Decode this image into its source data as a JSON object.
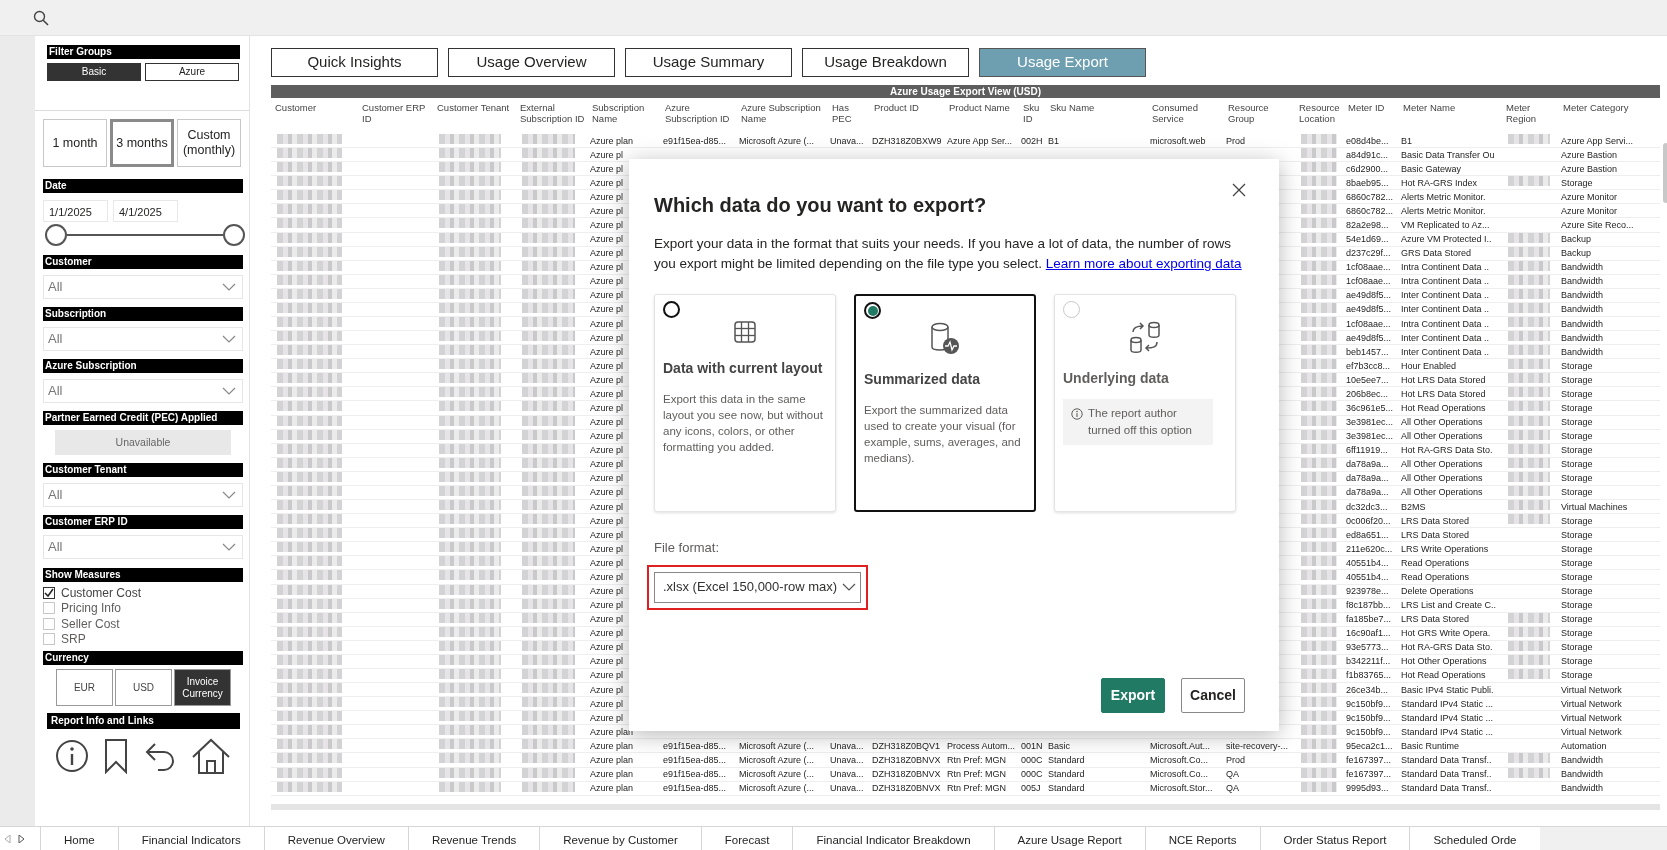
{
  "sidebar": {
    "filter_groups": {
      "title": "Filter Groups",
      "options": [
        {
          "label": "Basic",
          "selected": true
        },
        {
          "label": "Azure",
          "selected": false
        }
      ]
    },
    "periods": [
      {
        "label": "1 month",
        "selected": false
      },
      {
        "label": "3 months",
        "selected": true
      },
      {
        "label": "Custom (monthly)",
        "selected": false
      }
    ],
    "date": {
      "title": "Date",
      "start": "1/1/2025",
      "end": "4/1/2025",
      "level": 1
    },
    "filters": [
      {
        "kind": "dropdown",
        "title": "Customer",
        "value": "All"
      },
      {
        "kind": "dropdown",
        "title": "Subscription",
        "value": "All"
      },
      {
        "kind": "dropdown",
        "title": "Azure Subscription",
        "value": "All"
      },
      {
        "kind": "unavailable",
        "title": "Partner Earned Credit (PEC) Applied",
        "value": "Unavailable"
      },
      {
        "kind": "dropdown",
        "title": "Customer Tenant",
        "value": "All"
      },
      {
        "kind": "dropdown",
        "title": "Customer ERP ID",
        "value": "All"
      }
    ],
    "measures": {
      "title": "Show Measures",
      "items": [
        {
          "label": "Customer Cost",
          "checked": true
        },
        {
          "label": "Pricing Info",
          "checked": false
        },
        {
          "label": "Seller Cost",
          "checked": false
        },
        {
          "label": "SRP",
          "checked": false
        }
      ]
    },
    "currency": {
      "title": "Currency",
      "options": [
        {
          "label": "EUR",
          "selected": false
        },
        {
          "label": "USD",
          "selected": false
        },
        {
          "label": "Invoice Currency",
          "selected": true
        }
      ]
    },
    "report_info": {
      "title": "Report Info and Links"
    }
  },
  "tabs": [
    {
      "label": "Quick Insights",
      "selected": false
    },
    {
      "label": "Usage Overview",
      "selected": false
    },
    {
      "label": "Usage Summary",
      "selected": false
    },
    {
      "label": "Usage Breakdown",
      "selected": false
    },
    {
      "label": "Usage Export",
      "selected": true
    }
  ],
  "table": {
    "title": "Azure Usage Export View (USD)",
    "columns": [
      {
        "label": "Customer",
        "kind": "redacted"
      },
      {
        "label": "Customer ERP ID",
        "kind": "text"
      },
      {
        "label": "Customer Tenant",
        "kind": "redacted"
      },
      {
        "label": "External Subscription ID",
        "kind": "redacted"
      },
      {
        "label": "Subscription Name",
        "kind": "text"
      },
      {
        "label": "Azure Subscription ID",
        "kind": "text"
      },
      {
        "label": "Azure Subscription Name",
        "kind": "text"
      },
      {
        "label": "Has PEC",
        "kind": "text"
      },
      {
        "label": "Product ID",
        "kind": "text"
      },
      {
        "label": "Product Name",
        "kind": "text"
      },
      {
        "label": "Sku ID",
        "kind": "text"
      },
      {
        "label": "Sku Name",
        "kind": "text"
      },
      {
        "label": "Consumed Service",
        "kind": "text"
      },
      {
        "label": "Resource Group",
        "kind": "text"
      },
      {
        "label": "Resource Location",
        "kind": "redacted"
      },
      {
        "label": "Meter ID",
        "kind": "text"
      },
      {
        "label": "Meter Name",
        "kind": "text"
      },
      {
        "label": "Meter Region",
        "kind": "region"
      },
      {
        "label": "Meter Category",
        "kind": "text"
      }
    ],
    "rows": [
      {
        "region_redacted": true,
        "cells": {
          "subscription_name": "Azure plan",
          "azure_subscription_id": "e91f15ea-d85...",
          "azure_subscription_name": "Microsoft Azure (...",
          "has_pec": "Unava...",
          "product_id": "DZH318Z0BXW9",
          "product_name": "Azure App Ser...",
          "sku_id": "002H",
          "sku_name": "B1",
          "consumed_service": "microsoft.web",
          "resource_group": "Prod",
          "meter_id": "e08d4be...",
          "meter_name": "B1",
          "meter_category": "Azure App Servi..."
        }
      },
      {
        "region_redacted": false,
        "cells": {
          "subscription_name": "Azure pl",
          "meter_id": "a84d91c...",
          "meter_name": "Basic Data Transfer Ou",
          "meter_category": "Azure Bastion"
        }
      },
      {
        "region_redacted": false,
        "cells": {
          "subscription_name": "Azure pl",
          "meter_id": "c6d2900...",
          "meter_name": "Basic Gateway",
          "meter_category": "Azure Bastion"
        }
      },
      {
        "region_redacted": true,
        "cells": {
          "subscription_name": "Azure pl",
          "meter_id": "8baeb95...",
          "meter_name": "Hot RA-GRS Index",
          "meter_category": "Storage"
        }
      },
      {
        "region_redacted": false,
        "cells": {
          "subscription_name": "Azure pl",
          "meter_id": "6860c782...",
          "meter_name": "Alerts Metric Monitor.",
          "meter_category": "Azure Monitor"
        }
      },
      {
        "region_redacted": false,
        "cells": {
          "subscription_name": "Azure pl",
          "meter_id": "6860c782...",
          "meter_name": "Alerts Metric Monitor.",
          "meter_category": "Azure Monitor"
        }
      },
      {
        "region_redacted": false,
        "cells": {
          "subscription_name": "Azure pl",
          "meter_id": "82a2e98...",
          "meter_name": "VM Replicated to Az...",
          "meter_category": "Azure Site Reco..."
        }
      },
      {
        "region_redacted": true,
        "cells": {
          "subscription_name": "Azure pl",
          "meter_id": "54e1d69...",
          "meter_name": "Azure VM Protected I..",
          "meter_category": "Backup"
        }
      },
      {
        "region_redacted": true,
        "cells": {
          "subscription_name": "Azure pl",
          "meter_id": "d237c29f...",
          "meter_name": "GRS Data Stored",
          "meter_category": "Backup"
        }
      },
      {
        "region_redacted": true,
        "cells": {
          "subscription_name": "Azure pl",
          "meter_id": "1cf08aae...",
          "meter_name": "Intra Continent Data ..",
          "meter_category": "Bandwidth"
        }
      },
      {
        "region_redacted": true,
        "cells": {
          "subscription_name": "Azure pl",
          "meter_id": "1cf08aae...",
          "meter_name": "Intra Continent Data ..",
          "meter_category": "Bandwidth"
        }
      },
      {
        "region_redacted": true,
        "cells": {
          "subscription_name": "Azure pl",
          "meter_id": "ae49d8f5...",
          "meter_name": "Inter Continent Data ..",
          "meter_category": "Bandwidth"
        }
      },
      {
        "region_redacted": true,
        "cells": {
          "subscription_name": "Azure pl",
          "meter_id": "ae49d8f5...",
          "meter_name": "Inter Continent Data ..",
          "meter_category": "Bandwidth"
        }
      },
      {
        "region_redacted": true,
        "cells": {
          "subscription_name": "Azure pl",
          "meter_id": "1cf08aae...",
          "meter_name": "Intra Continent Data ..",
          "meter_category": "Bandwidth"
        }
      },
      {
        "region_redacted": true,
        "cells": {
          "subscription_name": "Azure pl",
          "meter_id": "ae49d8f5...",
          "meter_name": "Inter Continent Data ..",
          "meter_category": "Bandwidth"
        }
      },
      {
        "region_redacted": true,
        "cells": {
          "subscription_name": "Azure pl",
          "meter_id": "beb1457...",
          "meter_name": "Inter Continent Data ..",
          "meter_category": "Bandwidth"
        }
      },
      {
        "region_redacted": true,
        "cells": {
          "subscription_name": "Azure pl",
          "meter_id": "ef7b3cc8...",
          "meter_name": "Hour Enabled",
          "meter_category": "Storage"
        }
      },
      {
        "region_redacted": true,
        "cells": {
          "subscription_name": "Azure pl",
          "meter_id": "10e5ee7...",
          "meter_name": "Hot LRS Data Stored",
          "meter_category": "Storage"
        }
      },
      {
        "region_redacted": true,
        "cells": {
          "subscription_name": "Azure pl",
          "meter_id": "206b8ec...",
          "meter_name": "Hot LRS Data Stored",
          "meter_category": "Storage"
        }
      },
      {
        "region_redacted": true,
        "cells": {
          "subscription_name": "Azure pl",
          "meter_id": "36c961e5...",
          "meter_name": "Hot Read Operations",
          "meter_category": "Storage"
        }
      },
      {
        "region_redacted": true,
        "cells": {
          "subscription_name": "Azure pl",
          "meter_id": "3e3981ec...",
          "meter_name": "All Other Operations",
          "meter_category": "Storage"
        }
      },
      {
        "region_redacted": true,
        "cells": {
          "subscription_name": "Azure pl",
          "meter_id": "3e3981ec...",
          "meter_name": "All Other Operations",
          "meter_category": "Storage"
        }
      },
      {
        "region_redacted": true,
        "cells": {
          "subscription_name": "Azure pl",
          "meter_id": "6ff11919...",
          "meter_name": "Hot RA-GRS Data Sto.",
          "meter_category": "Storage"
        }
      },
      {
        "region_redacted": true,
        "cells": {
          "subscription_name": "Azure pl",
          "meter_id": "da78a9a...",
          "meter_name": "All Other Operations",
          "meter_category": "Storage"
        }
      },
      {
        "region_redacted": true,
        "cells": {
          "subscription_name": "Azure pl",
          "meter_id": "da78a9a...",
          "meter_name": "All Other Operations",
          "meter_category": "Storage"
        }
      },
      {
        "region_redacted": true,
        "cells": {
          "subscription_name": "Azure pl",
          "meter_id": "da78a9a...",
          "meter_name": "All Other Operations",
          "meter_category": "Storage"
        }
      },
      {
        "region_redacted": true,
        "cells": {
          "subscription_name": "Azure pl",
          "meter_id": "dc32dc3...",
          "meter_name": "B2MS",
          "meter_category": "Virtual Machines"
        }
      },
      {
        "region_redacted": true,
        "cells": {
          "subscription_name": "Azure pl",
          "meter_id": "0c006f20...",
          "meter_name": "LRS Data Stored",
          "meter_category": "Storage"
        }
      },
      {
        "region_redacted": false,
        "cells": {
          "subscription_name": "Azure pl",
          "meter_id": "ed8a651...",
          "meter_name": "LRS Data Stored",
          "meter_category": "Storage"
        }
      },
      {
        "region_redacted": false,
        "cells": {
          "subscription_name": "Azure pl",
          "meter_id": "211e620c...",
          "meter_name": "LRS Write Operations",
          "meter_category": "Storage"
        }
      },
      {
        "region_redacted": false,
        "cells": {
          "subscription_name": "Azure pl",
          "meter_id": "40551b4...",
          "meter_name": "Read Operations",
          "meter_category": "Storage"
        }
      },
      {
        "region_redacted": false,
        "cells": {
          "subscription_name": "Azure pl",
          "meter_id": "40551b4...",
          "meter_name": "Read Operations",
          "meter_category": "Storage"
        }
      },
      {
        "region_redacted": false,
        "cells": {
          "subscription_name": "Azure pl",
          "meter_id": "923978e...",
          "meter_name": "Delete Operations",
          "meter_category": "Storage"
        }
      },
      {
        "region_redacted": false,
        "cells": {
          "subscription_name": "Azure pl",
          "meter_id": "f8c187bb...",
          "meter_name": "LRS List and Create C..",
          "meter_category": "Storage"
        }
      },
      {
        "region_redacted": true,
        "cells": {
          "subscription_name": "Azure pl",
          "meter_id": "fa185be7...",
          "meter_name": "LRS Data Stored",
          "meter_category": "Storage"
        }
      },
      {
        "region_redacted": true,
        "cells": {
          "subscription_name": "Azure pl",
          "meter_id": "16c90af1...",
          "meter_name": "Hot GRS Write Opera.",
          "meter_category": "Storage"
        }
      },
      {
        "region_redacted": true,
        "cells": {
          "subscription_name": "Azure pl",
          "meter_id": "93e5773...",
          "meter_name": "Hot RA-GRS Data Sto.",
          "meter_category": "Storage"
        }
      },
      {
        "region_redacted": true,
        "cells": {
          "subscription_name": "Azure pl",
          "meter_id": "b342211f...",
          "meter_name": "Hot Other Operations",
          "meter_category": "Storage"
        }
      },
      {
        "region_redacted": true,
        "cells": {
          "subscription_name": "Azure pl",
          "meter_id": "f1b83765...",
          "meter_name": "Hot Read Operations",
          "meter_category": "Storage"
        }
      },
      {
        "region_redacted": false,
        "cells": {
          "subscription_name": "Azure pl",
          "meter_id": "26ce34b...",
          "meter_name": "Basic IPv4 Static Publi.",
          "meter_category": "Virtual Network"
        }
      },
      {
        "region_redacted": false,
        "cells": {
          "subscription_name": "Azure pl",
          "meter_id": "9c150bf9...",
          "meter_name": "Standard IPv4 Static ...",
          "meter_category": "Virtual Network"
        }
      },
      {
        "region_redacted": false,
        "cells": {
          "subscription_name": "Azure pl",
          "meter_id": "9c150bf9...",
          "meter_name": "Standard IPv4 Static ...",
          "meter_category": "Virtual Network"
        }
      },
      {
        "region_redacted": false,
        "cells": {
          "subscription_name": "Azure plan",
          "meter_id": "9c150bf9...",
          "meter_name": "Standard IPv4 Static ...",
          "meter_category": "Virtual Network"
        }
      },
      {
        "region_redacted": false,
        "cells": {
          "subscription_name": "Azure plan",
          "azure_subscription_id": "e91f15ea-d85...",
          "azure_subscription_name": "Microsoft Azure (...",
          "has_pec": "Unava...",
          "product_id": "DZH318Z0BQV1",
          "product_name": "Process Autom...",
          "sku_id": "001N",
          "sku_name": "Basic",
          "consumed_service": "Microsoft.Aut...",
          "resource_group": "site-recovery-...",
          "meter_id": "95eca2c1...",
          "meter_name": "Basic Runtime",
          "meter_category": "Automation"
        }
      },
      {
        "region_redacted": true,
        "cells": {
          "subscription_name": "Azure plan",
          "azure_subscription_id": "e91f15ea-d85...",
          "azure_subscription_name": "Microsoft Azure (...",
          "has_pec": "Unava...",
          "product_id": "DZH318Z0BNVX",
          "product_name": "Rtn Pref: MGN",
          "sku_id": "000C",
          "sku_name": "Standard",
          "consumed_service": "Microsoft.Co...",
          "resource_group": "Prod",
          "meter_id": "fe167397...",
          "meter_name": "Standard Data Transf..",
          "meter_category": "Bandwidth"
        }
      },
      {
        "region_redacted": true,
        "cells": {
          "subscription_name": "Azure plan",
          "azure_subscription_id": "e91f15ea-d85...",
          "azure_subscription_name": "Microsoft Azure (...",
          "has_pec": "Unava...",
          "product_id": "DZH318Z0BNVX",
          "product_name": "Rtn Pref: MGN",
          "sku_id": "000C",
          "sku_name": "Standard",
          "consumed_service": "Microsoft.Co...",
          "resource_group": "QA",
          "meter_id": "fe167397...",
          "meter_name": "Standard Data Transf..",
          "meter_category": "Bandwidth"
        }
      },
      {
        "region_redacted": false,
        "cells": {
          "subscription_name": "Azure plan",
          "azure_subscription_id": "e91f15ea-d85...",
          "azure_subscription_name": "Microsoft Azure (...",
          "has_pec": "Unava...",
          "product_id": "DZH318Z0BNVX",
          "product_name": "Rtn Pref: MGN",
          "sku_id": "005J",
          "sku_name": "Standard",
          "consumed_service": "Microsoft.Stor...",
          "resource_group": "QA",
          "meter_id": "9995d93...",
          "meter_name": "Standard Data Transf..",
          "meter_category": "Bandwidth"
        }
      }
    ]
  },
  "export_dialog": {
    "title": "Which data do you want to export?",
    "description": "Export your data in the format that suits your needs. If you have a lot of data, the number of rows you export might be limited depending on the file type you select.",
    "link": "Learn more about exporting data",
    "options": [
      {
        "kind": "grid",
        "title": "Data with current layout",
        "text": "Export this data in the same layout you see now, but without any icons, colors, or other formatting you added.",
        "selected": false,
        "disabled": false
      },
      {
        "kind": "summary",
        "title": "Summarized data",
        "text": "Export the summarized data used to create your visual (for example, sums, averages, and medians).",
        "selected": true,
        "disabled": false
      },
      {
        "kind": "underlying",
        "title": "Underlying data",
        "notice": "The report author turned off this option",
        "selected": false,
        "disabled": true
      }
    ],
    "file_format": {
      "label": "File format:",
      "value": ".xlsx (Excel 150,000-row max)",
      "highlighted": true
    },
    "buttons": [
      {
        "kind": "primary",
        "label": "Export"
      },
      {
        "kind": "secondary",
        "label": "Cancel"
      }
    ]
  },
  "page_tabs": [
    {
      "label": "Home"
    },
    {
      "label": "Financial Indicators"
    },
    {
      "label": "Revenue Overview"
    },
    {
      "label": "Revenue Trends"
    },
    {
      "label": "Revenue by Customer"
    },
    {
      "label": "Forecast"
    },
    {
      "label": "Financial Indicator Breakdown"
    },
    {
      "label": "Azure Usage Report"
    },
    {
      "label": "NCE Reports"
    },
    {
      "label": "Order Status Report"
    },
    {
      "label": "Scheduled Orde"
    }
  ]
}
